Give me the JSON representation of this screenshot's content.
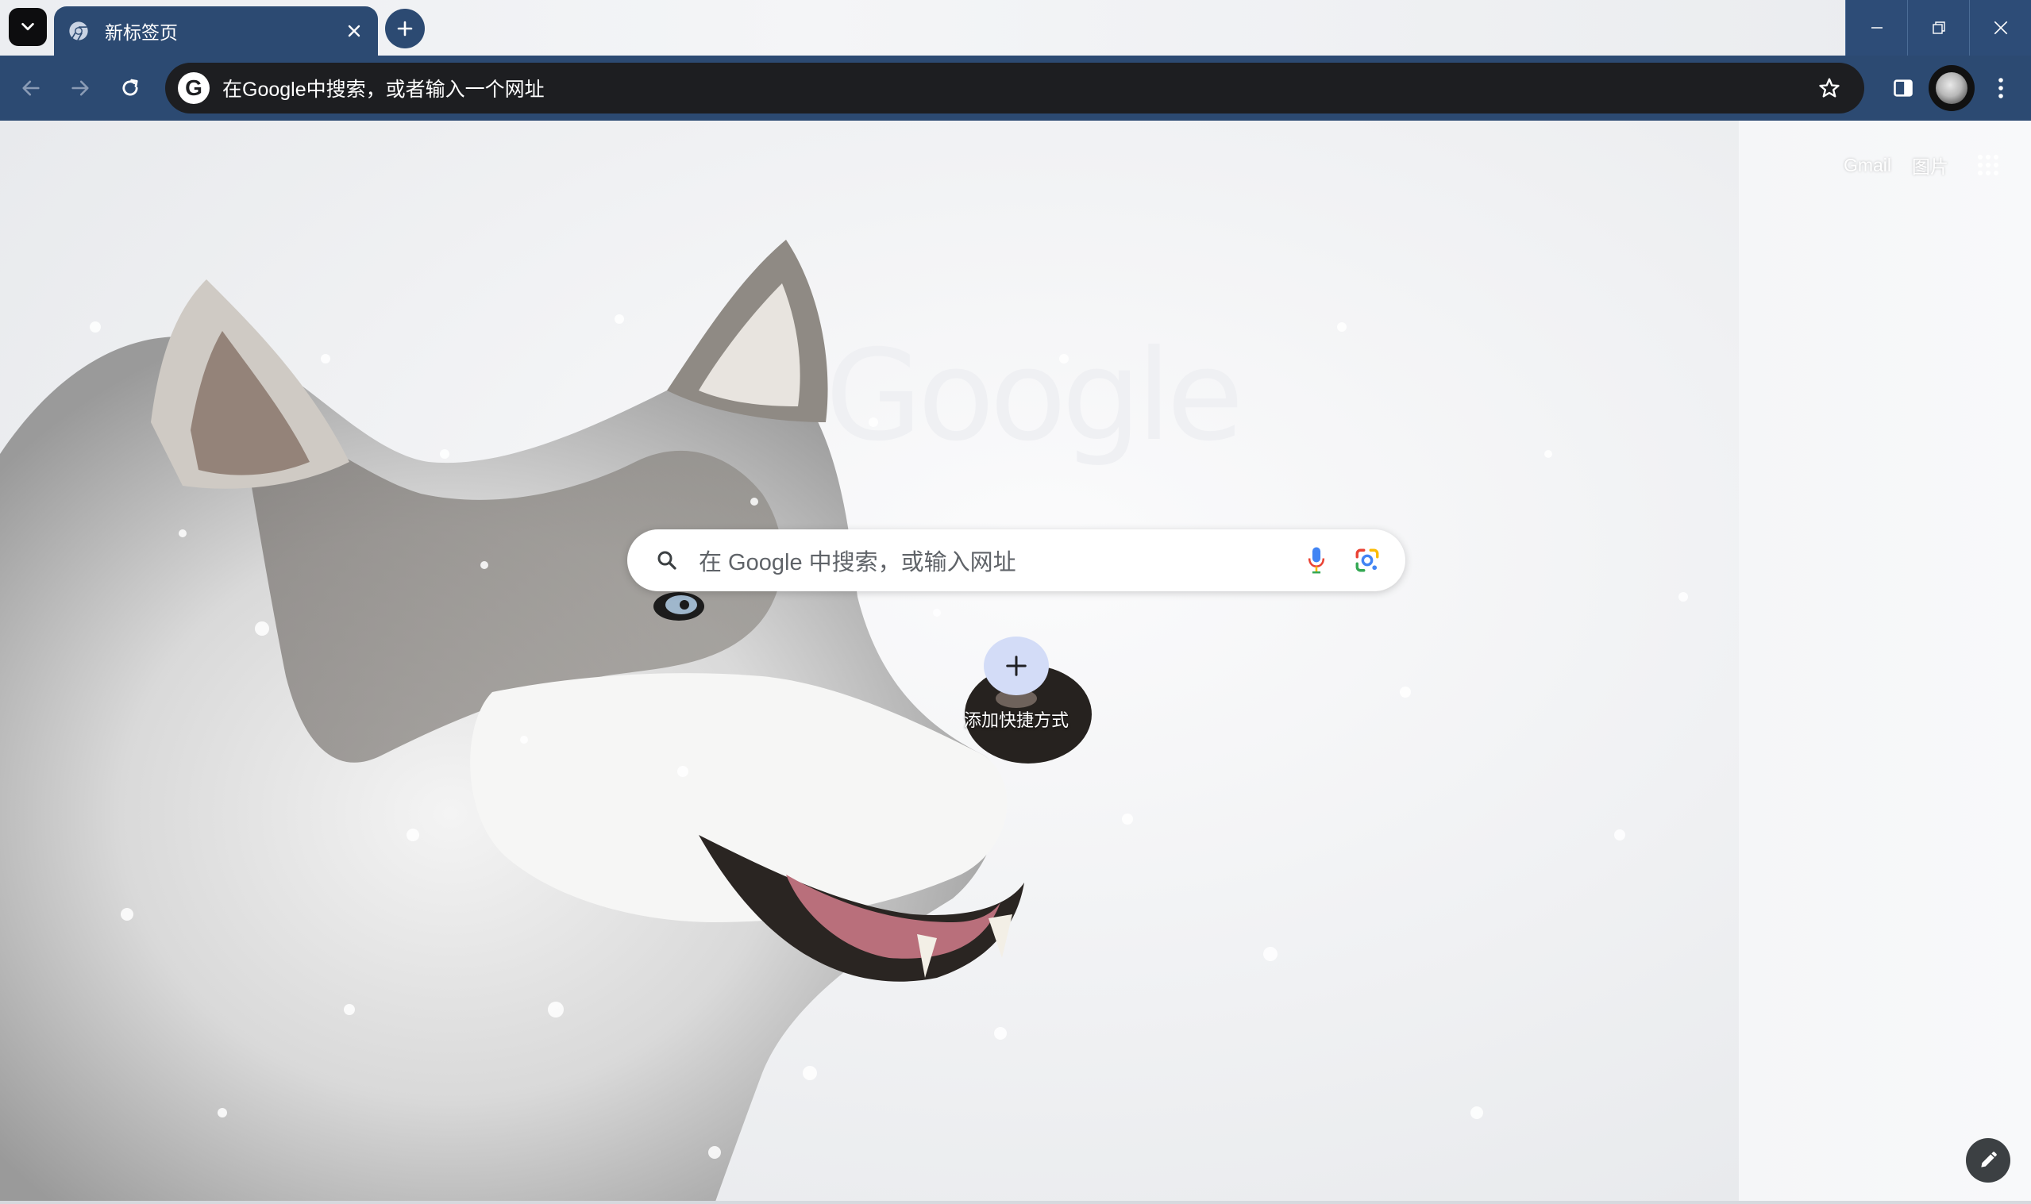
{
  "browser": {
    "tab": {
      "title": "新标签页"
    },
    "omnibox": {
      "placeholder": "在Google中搜索，或者输入一个网址"
    }
  },
  "ntp": {
    "top_links": {
      "gmail": "Gmail",
      "images": "图片"
    },
    "logo_text": "Google",
    "search": {
      "placeholder": "在 Google 中搜索，或输入网址"
    },
    "shortcut": {
      "label": "添加快捷方式"
    }
  },
  "colors": {
    "frame_accent": "#2c4a72",
    "omnibox_bg": "#1d1e21",
    "shortcut_circle": "#d3dcf7"
  }
}
